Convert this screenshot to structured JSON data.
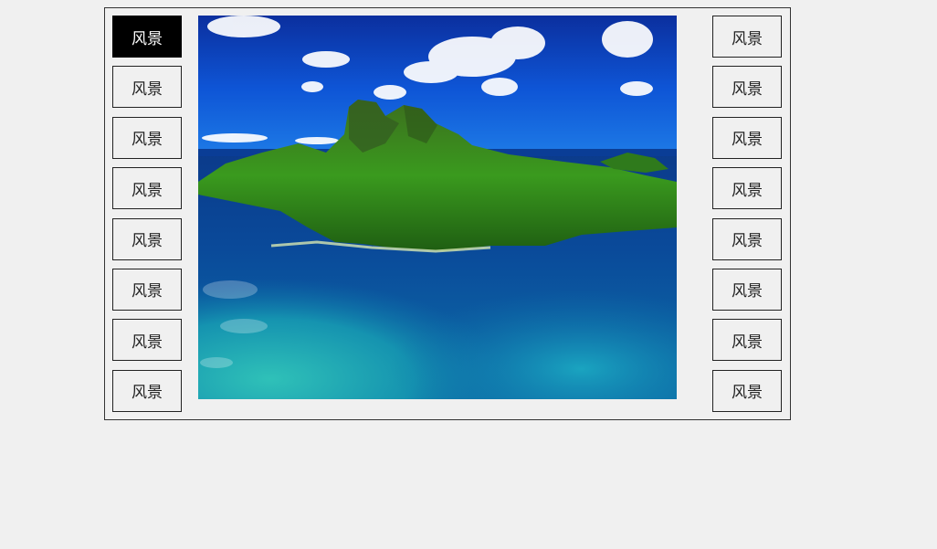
{
  "gallery": {
    "left_buttons": [
      {
        "label": "风景",
        "active": true
      },
      {
        "label": "风景",
        "active": false
      },
      {
        "label": "风景",
        "active": false
      },
      {
        "label": "风景",
        "active": false
      },
      {
        "label": "风景",
        "active": false
      },
      {
        "label": "风景",
        "active": false
      },
      {
        "label": "风景",
        "active": false
      },
      {
        "label": "风景",
        "active": false
      }
    ],
    "right_buttons": [
      {
        "label": "风景",
        "active": false
      },
      {
        "label": "风景",
        "active": false
      },
      {
        "label": "风景",
        "active": false
      },
      {
        "label": "风景",
        "active": false
      },
      {
        "label": "风景",
        "active": false
      },
      {
        "label": "风景",
        "active": false
      },
      {
        "label": "风景",
        "active": false
      },
      {
        "label": "风景",
        "active": false
      }
    ]
  },
  "colors": {
    "active_bg": "#000000",
    "active_text": "#ffffff",
    "button_border": "#222222",
    "page_bg": "#f0f0f0"
  }
}
